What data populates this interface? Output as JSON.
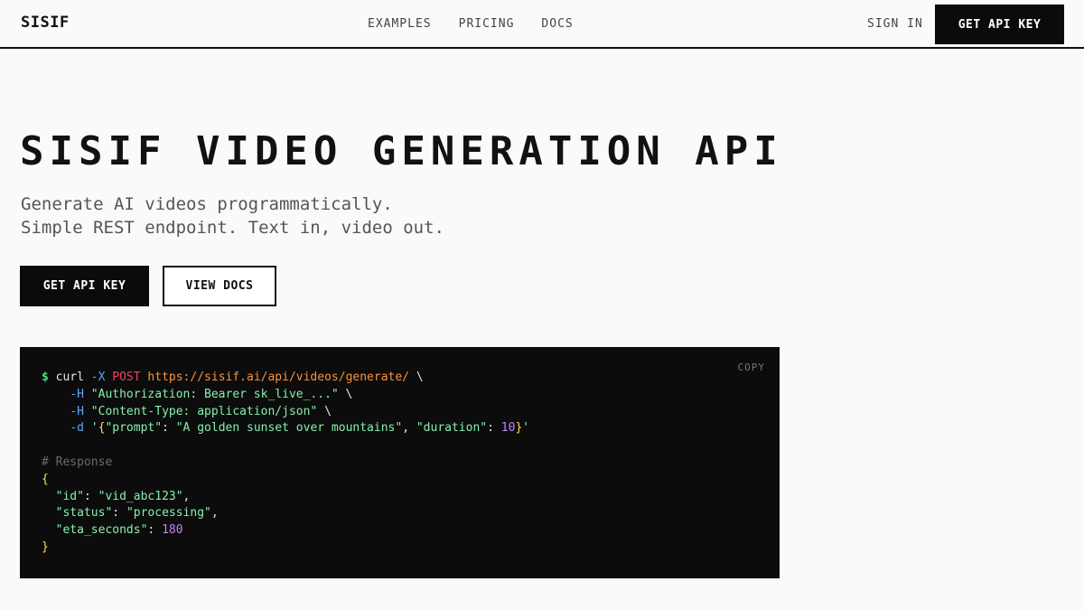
{
  "nav": {
    "logo": "SISIF",
    "links": [
      "EXAMPLES",
      "PRICING",
      "DOCS"
    ],
    "signin": "SIGN IN",
    "cta": "GET API KEY"
  },
  "hero": {
    "title": "SISIF VIDEO GENERATION API",
    "subtitle_lines": [
      "Generate AI videos programmatically.",
      "Simple REST endpoint. Text in, video out."
    ],
    "primary_button": "GET API KEY",
    "secondary_button": "VIEW DOCS"
  },
  "code": {
    "copy_label": "COPY",
    "prompt": "$",
    "command": "curl",
    "method_flag": "-X",
    "method": "POST",
    "url": "https://sisif.ai/api/videos/generate/",
    "header_flag": "-H",
    "auth_header": "\"Authorization: Bearer sk_live_...\"",
    "content_header": "\"Content-Type: application/json\"",
    "data_flag": "-d",
    "prompt_key": "\"prompt\"",
    "prompt_value": "\"A golden sunset over mountains\"",
    "duration_key": "\"duration\"",
    "duration_value": "10",
    "response_comment": "# Response",
    "response": {
      "id_key": "\"id\"",
      "id_value": "\"vid_abc123\"",
      "status_key": "\"status\"",
      "status_value": "\"processing\"",
      "eta_key": "\"eta_seconds\"",
      "eta_value": "180"
    }
  },
  "colors": {
    "background": "#fafafa",
    "ink": "#111111",
    "code_bg": "#0c0c0c",
    "prompt_green": "#4ade80",
    "flag_blue": "#60a5fa",
    "method_red": "#f43f5e",
    "url_orange": "#fb923c",
    "string_green": "#86efac",
    "number_purple": "#c084fc"
  }
}
